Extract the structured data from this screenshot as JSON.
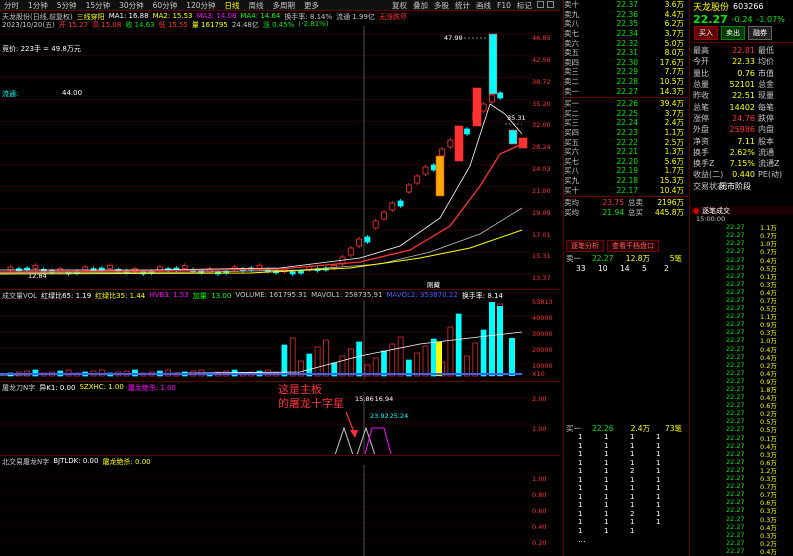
{
  "toolbar": {
    "items": [
      "分时",
      "1分钟",
      "5分钟",
      "15分钟",
      "30分钟",
      "60分钟",
      "120分钟",
      "日线",
      "周线",
      "多周期",
      "更多"
    ],
    "active_index": 7,
    "right_items": [
      "复权",
      "叠加",
      "多股",
      "统计",
      "画线",
      "F10",
      "标记"
    ]
  },
  "price_panel": {
    "info": [
      "天龙股份(日线,前复权)",
      "三线穿阳",
      "MA1: 16.88",
      "MA2: 15.53",
      "MA3: 14.08",
      "MA4: 14.64",
      "换手率: 8.14%",
      "流通 1.99亿",
      "无涨跌停"
    ],
    "info2": [
      "2023/10/20(五)",
      "开 15.27",
      "高 15.08",
      "收 14.63",
      "低 15.55",
      "量 161795",
      "24.48亿",
      "涨 0.45%",
      "(-2.81%)"
    ],
    "bid_text": "竞价: 223手 = 49.8万元",
    "float_label": "流通:",
    "float_value": "44.00",
    "peak_label": "47.90",
    "high_label": "35.31",
    "low_label": "12.84",
    "status_label": "刚藏",
    "yaxis": [
      "46.85",
      "42.59",
      "38.72",
      "35.20",
      "32.00",
      "28.24",
      "24.03",
      "21.00",
      "19.09",
      "17.01",
      "15.31",
      "13.37"
    ]
  },
  "volume_panel": {
    "info": [
      "成交量VOL",
      "红绿比65: 1.19",
      "红绿比35: 1.44",
      "HVB3: 1.53",
      "加量: 13.00",
      "VOLUME: 161795.31",
      "MAVOL1: 258735.91",
      "MAVOL2: 353870.22",
      "换手率: 8.14"
    ],
    "yaxis": [
      "53813",
      "40000",
      "30000",
      "20000",
      "10000"
    ],
    "yaxis_unit": "X10"
  },
  "indicator1": {
    "info": [
      "屠龙刀N字",
      "异K1: 0.00",
      "SZXHC: 1.00",
      "屠龙绝杀: 1.00"
    ],
    "yaxis": [
      "2.00",
      "1.00"
    ],
    "val_top": "15.86",
    "val_top2": "16.94",
    "val_mid": "23.92",
    "val_mid2": "25.24"
  },
  "indicator2": {
    "info": [
      "北交易屠龙N字",
      "BJTLDK: 0.00",
      "屠龙绝杀: 0.00"
    ],
    "yaxis": [
      "1.00",
      "0.80",
      "0.60",
      "0.40",
      "0.20"
    ]
  },
  "annotation": {
    "line1": "这是主板",
    "line2": "的屠龙十字星"
  },
  "order_book": {
    "asks": [
      {
        "label": "卖十",
        "price": "22.37",
        "vol": "3.6万"
      },
      {
        "label": "卖九",
        "price": "22.36",
        "vol": "4.4万"
      },
      {
        "label": "卖八",
        "price": "22.35",
        "vol": "6.2万"
      },
      {
        "label": "卖七",
        "price": "22.34",
        "vol": "3.7万"
      },
      {
        "label": "卖六",
        "price": "22.32",
        "vol": "5.0万"
      },
      {
        "label": "卖五",
        "price": "22.31",
        "vol": "8.0万"
      },
      {
        "label": "卖四",
        "price": "22.30",
        "vol": "17.6万"
      },
      {
        "label": "卖三",
        "price": "22.29",
        "vol": "7.7万"
      },
      {
        "label": "卖二",
        "price": "22.28",
        "vol": "10.5万"
      },
      {
        "label": "卖一",
        "price": "22.27",
        "vol": "14.3万"
      }
    ],
    "bids": [
      {
        "label": "买一",
        "price": "22.26",
        "vol": "39.4万"
      },
      {
        "label": "买二",
        "price": "22.25",
        "vol": "3.7万"
      },
      {
        "label": "买三",
        "price": "22.24",
        "vol": "2.4万"
      },
      {
        "label": "买四",
        "price": "22.23",
        "vol": "1.1万"
      },
      {
        "label": "买五",
        "price": "22.22",
        "vol": "2.5万"
      },
      {
        "label": "买六",
        "price": "22.21",
        "vol": "1.3万"
      },
      {
        "label": "买七",
        "price": "22.20",
        "vol": "5.6万"
      },
      {
        "label": "买八",
        "price": "22.19",
        "vol": "1.7万"
      },
      {
        "label": "买九",
        "price": "22.18",
        "vol": "15.3万"
      },
      {
        "label": "买十",
        "price": "22.17",
        "vol": "10.4万"
      }
    ],
    "sum_ask": {
      "label": "卖均",
      "price": "23.75",
      "k": "总卖",
      "v": "2196万"
    },
    "sum_bid": {
      "label": "买均",
      "price": "21.94",
      "k": "总买",
      "v": "445.8万"
    }
  },
  "stock": {
    "name": "天龙股份",
    "code": "603266",
    "price": "22.27",
    "change": "-0.24",
    "pct": "-1.07%",
    "buy_btn": "买入",
    "sell_btn": "卖出",
    "margin_btn": "融券",
    "quotes": [
      {
        "k": "最高",
        "v": "22.81",
        "k2": "最低",
        "v2": ""
      },
      {
        "k": "今开",
        "v": "22.33",
        "k2": "均价",
        "v2": ""
      },
      {
        "k": "量比",
        "v": "0.76",
        "k2": "市值",
        "v2": ""
      },
      {
        "k": "总量",
        "v": "52101",
        "k2": "总金",
        "v2": ""
      },
      {
        "k": "昨收",
        "v": "22.51",
        "k2": "现量",
        "v2": ""
      },
      {
        "k": "总笔",
        "v": "14402",
        "k2": "每笔",
        "v2": ""
      },
      {
        "k": "涨停",
        "v": "24.76",
        "k2": "跌停",
        "v2": ""
      },
      {
        "k": "外盘",
        "v": "25986",
        "k2": "内盘",
        "v2": ""
      },
      {
        "k": "净资",
        "v": "7.11",
        "k2": "股本",
        "v2": ""
      },
      {
        "k": "换手",
        "v": "2.62%",
        "k2": "流通",
        "v2": ""
      },
      {
        "k": "换手Z",
        "v": "7.15%",
        "k2": "流通Z",
        "v2": ""
      },
      {
        "k": "收益(二)",
        "v": "0.440",
        "k2": "PE(动)",
        "v2": ""
      },
      {
        "k": "交易状态:",
        "v": "闭市阶段",
        "k2": "",
        "v2": ""
      }
    ]
  },
  "ticks_panel": {
    "title": "逐笔成交",
    "time0": "15:00:00",
    "rows": [
      {
        "t": "",
        "p": "22.27",
        "v": "1.1万"
      },
      {
        "t": "",
        "p": "22.27",
        "v": "0.7万"
      },
      {
        "t": "",
        "p": "22.27",
        "v": "1.0万"
      },
      {
        "t": "",
        "p": "22.27",
        "v": "0.7万"
      },
      {
        "t": "",
        "p": "22.27",
        "v": "0.4万"
      },
      {
        "t": "",
        "p": "22.27",
        "v": "0.5万"
      },
      {
        "t": "",
        "p": "22.27",
        "v": "0.1万"
      },
      {
        "t": "",
        "p": "22.27",
        "v": "0.3万"
      },
      {
        "t": "",
        "p": "22.27",
        "v": "0.4万"
      },
      {
        "t": "",
        "p": "22.27",
        "v": "0.7万"
      },
      {
        "t": "",
        "p": "22.27",
        "v": "0.5万"
      },
      {
        "t": "",
        "p": "22.27",
        "v": "1.1万"
      },
      {
        "t": "",
        "p": "22.27",
        "v": "0.9万"
      },
      {
        "t": "",
        "p": "22.27",
        "v": "0.3万"
      },
      {
        "t": "",
        "p": "22.27",
        "v": "1.0万"
      },
      {
        "t": "",
        "p": "22.27",
        "v": "0.4万"
      },
      {
        "t": "",
        "p": "22.27",
        "v": "0.4万"
      },
      {
        "t": "",
        "p": "22.27",
        "v": "0.2万"
      },
      {
        "t": "",
        "p": "22.27",
        "v": "0.4万"
      },
      {
        "t": "",
        "p": "22.27",
        "v": "0.9万"
      },
      {
        "t": "",
        "p": "22.27",
        "v": "1.8万"
      },
      {
        "t": "",
        "p": "22.27",
        "v": "0.4万"
      },
      {
        "t": "",
        "p": "22.27",
        "v": "0.6万"
      },
      {
        "t": "",
        "p": "22.27",
        "v": "0.2万"
      },
      {
        "t": "",
        "p": "22.27",
        "v": "0.5万"
      },
      {
        "t": "",
        "p": "22.27",
        "v": "0.5万"
      },
      {
        "t": "",
        "p": "22.27",
        "v": "0.1万"
      },
      {
        "t": "",
        "p": "22.27",
        "v": "0.4万"
      },
      {
        "t": "",
        "p": "22.27",
        "v": "0.3万"
      },
      {
        "t": "",
        "p": "22.27",
        "v": "0.6万"
      },
      {
        "t": "",
        "p": "22.27",
        "v": "1.2万"
      },
      {
        "t": "",
        "p": "22.27",
        "v": "0.3万"
      },
      {
        "t": "",
        "p": "22.27",
        "v": "0.7万"
      },
      {
        "t": "",
        "p": "22.27",
        "v": "0.7万"
      },
      {
        "t": "",
        "p": "22.27",
        "v": "0.6万"
      },
      {
        "t": "",
        "p": "22.27",
        "v": "0.3万"
      },
      {
        "t": "",
        "p": "22.27",
        "v": "0.3万"
      },
      {
        "t": "",
        "p": "22.27",
        "v": "0.4万"
      },
      {
        "t": "",
        "p": "22.27",
        "v": "0.3万"
      },
      {
        "t": "",
        "p": "22.27",
        "v": "0.2万"
      },
      {
        "t": "",
        "p": "22.27",
        "v": "0.4万"
      }
    ]
  },
  "queue_panel": {
    "tab1": "逐笔分析",
    "tab2": "查看千档盘口",
    "ask1": {
      "label": "卖一",
      "price": "22.27",
      "vol": "12.8万",
      "unit": "笔",
      "count": "5笔"
    },
    "ask_nums": [
      "33",
      "10",
      "14",
      "5",
      "2"
    ],
    "bid1": {
      "label": "买一",
      "price": "22.26",
      "vol": "2.4万",
      "unit": "笔",
      "count": "73笔"
    },
    "bid_rows": [
      [
        "1",
        "1",
        "1",
        "1"
      ],
      [
        "1",
        "1",
        "1",
        "1"
      ],
      [
        "1",
        "1",
        "1",
        "1"
      ],
      [
        "1",
        "1",
        "1",
        "1"
      ],
      [
        "1",
        "1",
        "2",
        "1"
      ],
      [
        "1",
        "1",
        "1",
        "1"
      ],
      [
        "1",
        "1",
        "1",
        "1"
      ],
      [
        "1",
        "1",
        "1",
        "1"
      ],
      [
        "1",
        "1",
        "1",
        "1"
      ],
      [
        "1",
        "1",
        "2",
        "1"
      ],
      [
        "1",
        "1",
        "1",
        "1"
      ],
      [
        "1",
        "1",
        "1",
        ""
      ]
    ],
    "ellipsis": "..."
  },
  "colors": {
    "up": "#ff3232",
    "down": "#00e600",
    "ma1": "#ffffff",
    "ma2": "#ffff00",
    "ma3": "#ff00ff"
  }
}
